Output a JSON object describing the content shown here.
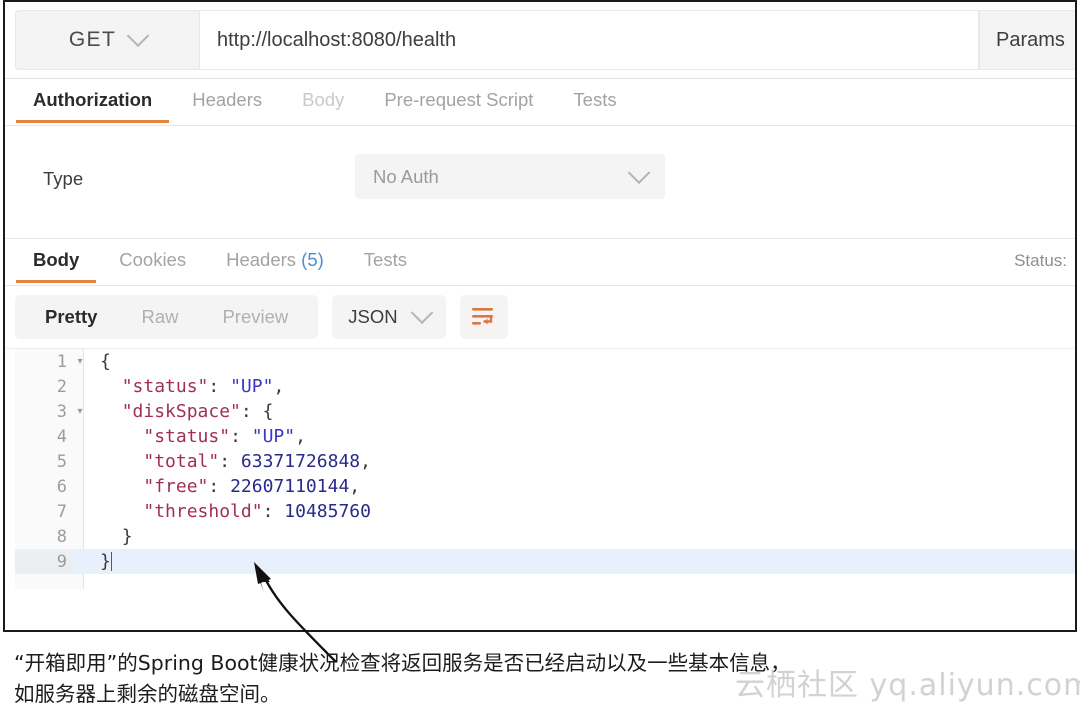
{
  "request": {
    "method": "GET",
    "url": "http://localhost:8080/health",
    "params_label": "Params",
    "tabs": [
      {
        "label": "Authorization",
        "state": "active"
      },
      {
        "label": "Headers",
        "state": "normal"
      },
      {
        "label": "Body",
        "state": "dim"
      },
      {
        "label": "Pre-request Script",
        "state": "normal"
      },
      {
        "label": "Tests",
        "state": "normal"
      }
    ],
    "auth": {
      "type_label": "Type",
      "selected": "No Auth"
    }
  },
  "response": {
    "tabs": [
      {
        "label": "Body",
        "state": "active"
      },
      {
        "label": "Cookies",
        "state": "normal"
      },
      {
        "label": "Headers",
        "count": "(5)",
        "state": "normal"
      },
      {
        "label": "Tests",
        "state": "normal"
      }
    ],
    "status_label": "Status:",
    "view_modes": [
      {
        "label": "Pretty",
        "state": "active"
      },
      {
        "label": "Raw",
        "state": "normal"
      },
      {
        "label": "Preview",
        "state": "normal"
      }
    ],
    "format": "JSON",
    "wrap_icon": "word-wrap-icon",
    "code_lines": [
      {
        "num": "1",
        "fold": "▾",
        "indent": 0,
        "tokens": [
          {
            "t": "{",
            "c": "p"
          }
        ]
      },
      {
        "num": "2",
        "fold": "",
        "indent": 1,
        "tokens": [
          {
            "t": "\"status\"",
            "c": "k"
          },
          {
            "t": ": ",
            "c": "p"
          },
          {
            "t": "\"UP\"",
            "c": "s"
          },
          {
            "t": ",",
            "c": "p"
          }
        ]
      },
      {
        "num": "3",
        "fold": "▾",
        "indent": 1,
        "tokens": [
          {
            "t": "\"diskSpace\"",
            "c": "k"
          },
          {
            "t": ": ",
            "c": "p"
          },
          {
            "t": "{",
            "c": "p"
          }
        ]
      },
      {
        "num": "4",
        "fold": "",
        "indent": 2,
        "tokens": [
          {
            "t": "\"status\"",
            "c": "k"
          },
          {
            "t": ": ",
            "c": "p"
          },
          {
            "t": "\"UP\"",
            "c": "s"
          },
          {
            "t": ",",
            "c": "p"
          }
        ]
      },
      {
        "num": "5",
        "fold": "",
        "indent": 2,
        "tokens": [
          {
            "t": "\"total\"",
            "c": "k"
          },
          {
            "t": ": ",
            "c": "p"
          },
          {
            "t": "63371726848",
            "c": "n"
          },
          {
            "t": ",",
            "c": "p"
          }
        ]
      },
      {
        "num": "6",
        "fold": "",
        "indent": 2,
        "tokens": [
          {
            "t": "\"free\"",
            "c": "k"
          },
          {
            "t": ": ",
            "c": "p"
          },
          {
            "t": "22607110144",
            "c": "n"
          },
          {
            "t": ",",
            "c": "p"
          }
        ]
      },
      {
        "num": "7",
        "fold": "",
        "indent": 2,
        "tokens": [
          {
            "t": "\"threshold\"",
            "c": "k"
          },
          {
            "t": ": ",
            "c": "p"
          },
          {
            "t": "10485760",
            "c": "n"
          }
        ]
      },
      {
        "num": "8",
        "fold": "",
        "indent": 1,
        "tokens": [
          {
            "t": "}",
            "c": "p"
          }
        ]
      },
      {
        "num": "9",
        "fold": "",
        "indent": 0,
        "highlight": true,
        "caret": true,
        "tokens": [
          {
            "t": "}",
            "c": "p"
          }
        ]
      }
    ],
    "json_values": {
      "status": "UP",
      "diskSpace": {
        "status": "UP",
        "total": "63371726848",
        "free": "22607110144",
        "threshold": "10485760"
      }
    }
  },
  "caption": {
    "line1": "“开箱即用”的Spring Boot健康状况检查将返回服务是否已经启动以及一些基本信息，",
    "line2": "如服务器上剩余的磁盘空间。"
  },
  "watermark": {
    "text": "云栖社区 yq.aliyun.com"
  },
  "colors": {
    "accent_orange": "#e8833a",
    "json_key": "#a03050",
    "json_string": "#3b35c9",
    "json_number": "#2a2a8c",
    "badge_blue": "#4b8fd1",
    "highlight_row": "#e8f0fb"
  }
}
